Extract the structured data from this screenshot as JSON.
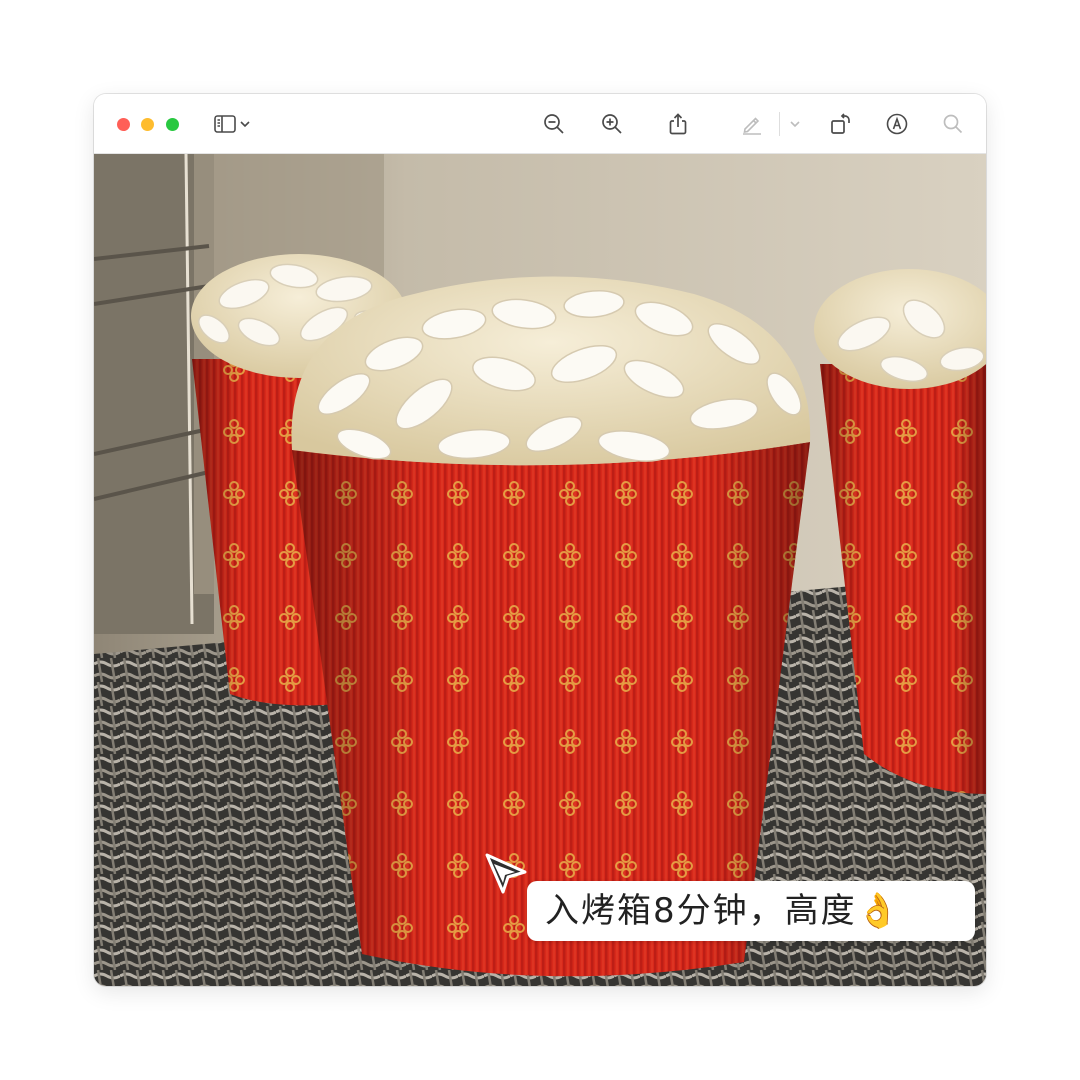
{
  "window": {
    "traffic_lights": {
      "close_color": "#ff5f57",
      "minimize_color": "#febc2e",
      "zoom_color": "#28c840"
    },
    "toolbar": {
      "icons": {
        "sidebar_toggle": "sidebar-icon",
        "sidebar_menu": "chevron-down-icon",
        "zoom_out": "zoom-out-icon",
        "zoom_in": "zoom-in-icon",
        "share": "share-icon",
        "markup_pen": "pen-icon",
        "markup_menu": "chevron-down-icon",
        "rotate": "rotate-icon",
        "markup": "markup-icon",
        "search": "search-icon"
      },
      "icon_color": "#4a4a4a",
      "disabled_icon_color": "#bdbdbd"
    }
  },
  "content": {
    "caption": "入烤箱8分钟，高度👌"
  },
  "colors": {
    "panettone_paper": "#d8281a",
    "gold_pattern": "#e7b046",
    "almond_top": "#efe3c4"
  }
}
